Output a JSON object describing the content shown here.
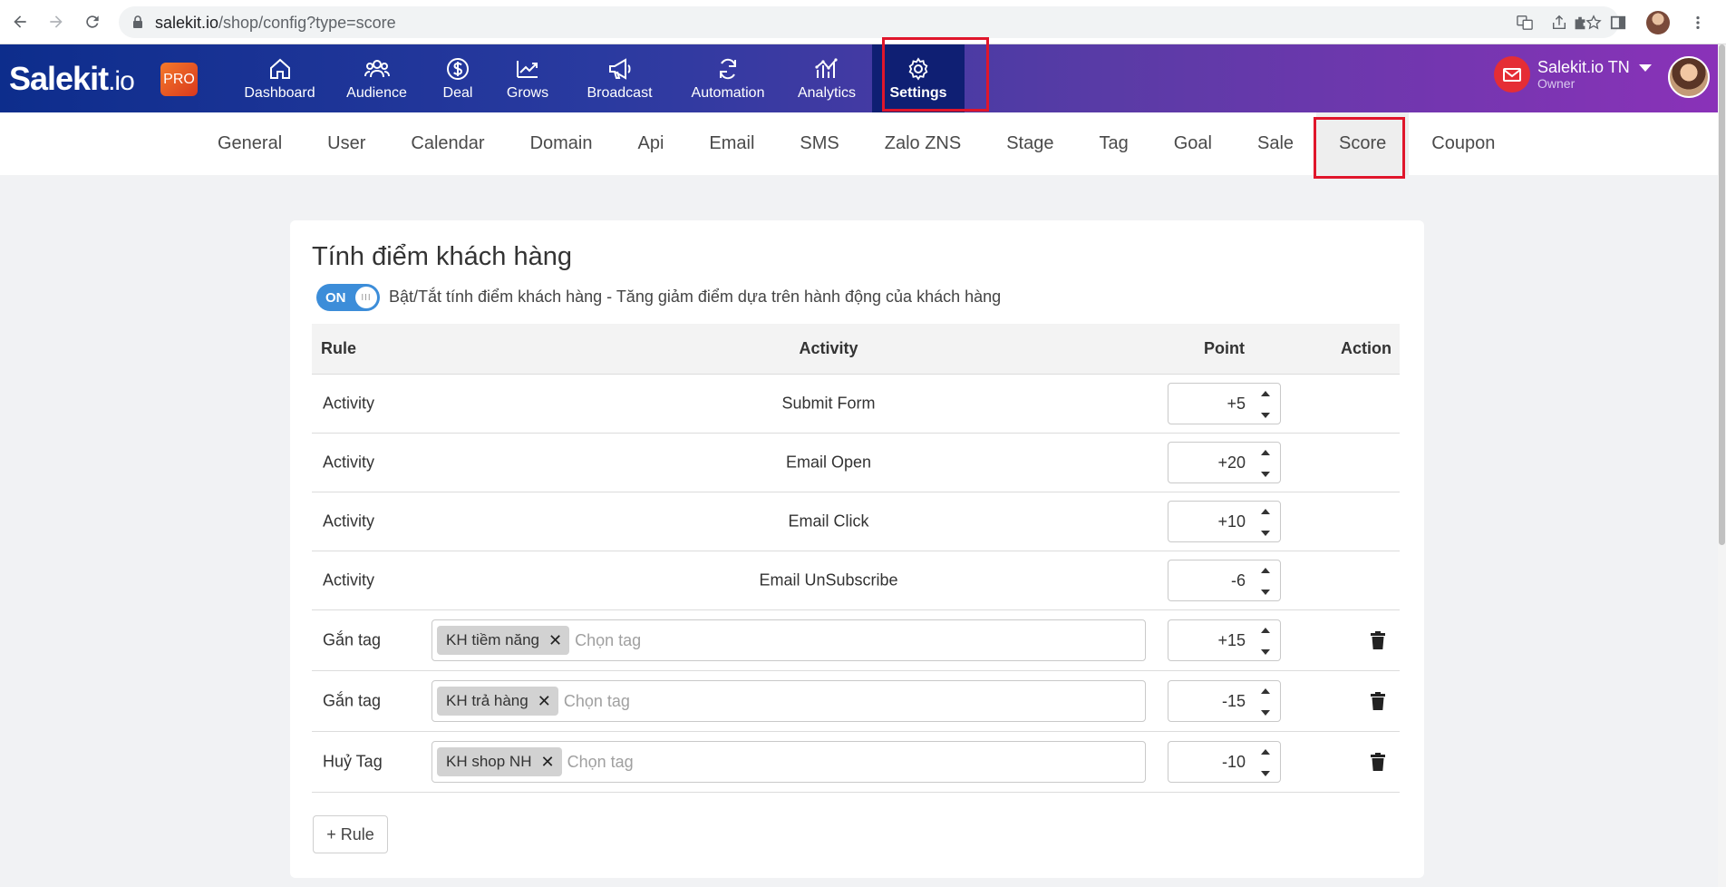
{
  "browser": {
    "url_host": "salekit.io",
    "url_path": "/shop/config?type=score"
  },
  "header": {
    "logo": "Salekit",
    "logo_suffix": ".io",
    "badge": "PRO",
    "nav": [
      {
        "label": "Dashboard",
        "icon": "home-icon"
      },
      {
        "label": "Audience",
        "icon": "users-icon"
      },
      {
        "label": "Deal",
        "icon": "dollar-icon"
      },
      {
        "label": "Grows",
        "icon": "trend-icon"
      },
      {
        "label": "Broadcast",
        "icon": "megaphone-icon"
      },
      {
        "label": "Automation",
        "icon": "refresh-icon"
      },
      {
        "label": "Analytics",
        "icon": "analytics-icon"
      },
      {
        "label": "Settings",
        "icon": "gear-icon"
      }
    ],
    "account": {
      "name": "Salekit.io TN",
      "role": "Owner"
    }
  },
  "subnav": {
    "tabs": [
      "General",
      "User",
      "Calendar",
      "Domain",
      "Api",
      "Email",
      "SMS",
      "Zalo ZNS",
      "Stage",
      "Tag",
      "Goal",
      "Sale",
      "Score",
      "Coupon"
    ],
    "active": "Score"
  },
  "card": {
    "title": "Tính điểm khách hàng",
    "toggle_label": "ON",
    "toggle_knob": "III",
    "toggle_desc": "Bật/Tắt tính điểm khách hàng - Tăng giảm điểm dựa trên hành động của khách hàng",
    "columns": {
      "rule": "Rule",
      "activity": "Activity",
      "point": "Point",
      "action": "Action"
    },
    "rows": [
      {
        "rule": "Activity",
        "activity": "Submit Form",
        "point": "+5"
      },
      {
        "rule": "Activity",
        "activity": "Email Open",
        "point": "+20"
      },
      {
        "rule": "Activity",
        "activity": "Email Click",
        "point": "+10"
      },
      {
        "rule": "Activity",
        "activity": "Email UnSubscribe",
        "point": "-6"
      }
    ],
    "tag_rows": [
      {
        "rule": "Gắn tag",
        "tag": "KH tiềm năng",
        "placeholder": "Chọn tag",
        "point": "+15"
      },
      {
        "rule": "Gắn tag",
        "tag": "KH trả hàng",
        "placeholder": "Chọn tag",
        "point": "-15"
      },
      {
        "rule": "Huỷ Tag",
        "tag": "KH shop NH",
        "placeholder": "Chọn tag",
        "point": "-10"
      }
    ],
    "add_rule": "+ Rule"
  }
}
